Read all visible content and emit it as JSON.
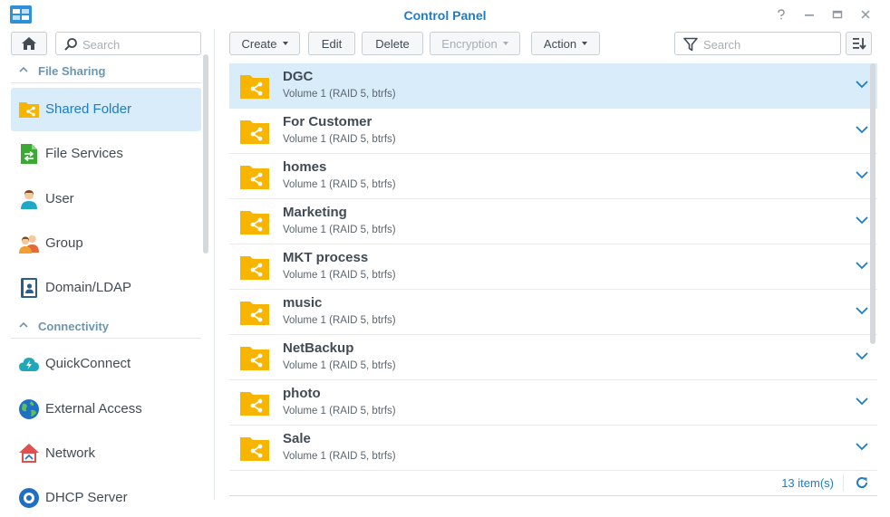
{
  "window": {
    "title": "Control Panel",
    "accent_color": "#1e7cc8",
    "controls": [
      "help-icon",
      "minimize-icon",
      "maximize-icon",
      "close-icon"
    ]
  },
  "sidebar": {
    "search_placeholder": "Search",
    "sections": [
      {
        "label": "File Sharing",
        "items": [
          {
            "label": "Shared Folder",
            "icon": "shared-folder-icon",
            "active": true
          },
          {
            "label": "File Services",
            "icon": "file-services-icon"
          },
          {
            "label": "User",
            "icon": "user-icon"
          },
          {
            "label": "Group",
            "icon": "group-icon"
          },
          {
            "label": "Domain/LDAP",
            "icon": "domain-ldap-icon"
          }
        ]
      },
      {
        "label": "Connectivity",
        "items": [
          {
            "label": "QuickConnect",
            "icon": "quickconnect-icon"
          },
          {
            "label": "External Access",
            "icon": "external-access-icon"
          },
          {
            "label": "Network",
            "icon": "network-icon"
          },
          {
            "label": "DHCP Server",
            "icon": "dhcp-server-icon"
          }
        ]
      }
    ]
  },
  "toolbar": {
    "create_label": "Create",
    "edit_label": "Edit",
    "delete_label": "Delete",
    "encryption_label": "Encryption",
    "action_label": "Action",
    "filter_placeholder": "Search"
  },
  "folders": [
    {
      "name": "DGC",
      "volume": "Volume 1 (RAID 5, btrfs)",
      "selected": true
    },
    {
      "name": "For Customer",
      "volume": "Volume 1 (RAID 5, btrfs)"
    },
    {
      "name": "homes",
      "volume": "Volume 1 (RAID 5, btrfs)"
    },
    {
      "name": "Marketing",
      "volume": "Volume 1 (RAID 5, btrfs)"
    },
    {
      "name": "MKT process",
      "volume": "Volume 1 (RAID 5, btrfs)"
    },
    {
      "name": "music",
      "volume": "Volume 1 (RAID 5, btrfs)"
    },
    {
      "name": "NetBackup",
      "volume": "Volume 1 (RAID 5, btrfs)"
    },
    {
      "name": "photo",
      "volume": "Volume 1 (RAID 5, btrfs)"
    },
    {
      "name": "Sale",
      "volume": "Volume 1 (RAID 5, btrfs)"
    }
  ],
  "footer": {
    "item_count": "13 item(s)"
  }
}
